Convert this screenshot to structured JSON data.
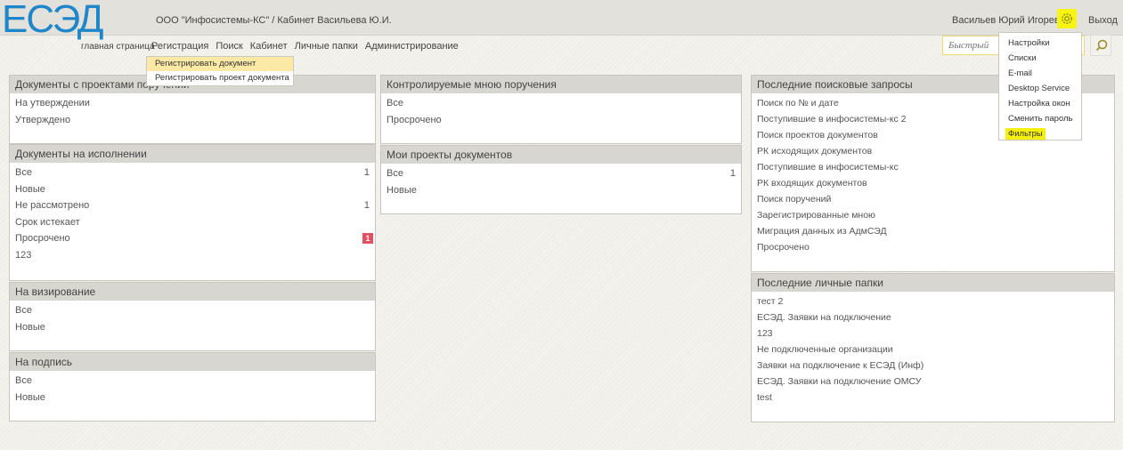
{
  "header": {
    "logo": "ЕСЭД",
    "logo_sub": "главная страница",
    "organization": "ООО \"Инфосистемы-КС\" / Кабинет Васильева Ю.И.",
    "user_name": "Васильев Юрий Игоревич",
    "logout": "Выход",
    "search_placeholder": "Быстрый",
    "accent_color": "#1f87c9",
    "highlight_color": "#f7f312"
  },
  "menu": {
    "items": [
      "Регистрация",
      "Поиск",
      "Кабинет",
      "Личные папки",
      "Администрирование"
    ]
  },
  "registration_dropdown": {
    "items": [
      "Регистрировать документ",
      "Регистрировать проект документа"
    ]
  },
  "settings_menu": {
    "items": [
      "Настройки",
      "Списки",
      "E-mail",
      "Desktop Service",
      "Настройка окон",
      "Сменить пароль",
      "Фильтры"
    ]
  },
  "panels": {
    "projects": {
      "title": "Документы с проектами поручений",
      "items": [
        "На утверждении",
        "Утверждено"
      ]
    },
    "execution": {
      "title": "Документы на исполнении",
      "items": [
        {
          "label": "Все",
          "count": "1"
        },
        {
          "label": "Новые",
          "count": ""
        },
        {
          "label": "Не рассмотрено",
          "count": "1"
        },
        {
          "label": "Срок истекает",
          "count": ""
        },
        {
          "label": "Просрочено",
          "badge": "1"
        },
        {
          "label": "123",
          "count": ""
        }
      ]
    },
    "vising": {
      "title": "На визирование",
      "items": [
        "Все",
        "Новые"
      ]
    },
    "signing": {
      "title": "На подпись",
      "items": [
        "Все",
        "Новые"
      ]
    },
    "controlled": {
      "title": "Контролируемые мною поручения",
      "items": [
        "Все",
        "Просрочено"
      ]
    },
    "my_projects": {
      "title": "Мои проекты документов",
      "items": [
        {
          "label": "Все",
          "count": "1"
        },
        {
          "label": "Новые",
          "count": ""
        }
      ]
    },
    "searches": {
      "title": "Последние поисковые запросы",
      "items": [
        "Поиск по № и дате",
        "Поступившие в инфосистемы-кс 2",
        "Поиск проектов документов",
        "РК исходящих документов",
        "Поступившие в инфосистемы-кс",
        "РК входящих документов",
        "Поиск поручений",
        "Зарегистрированные мною",
        "Миграция данных из АдмСЭД",
        "Просрочено"
      ]
    },
    "folders": {
      "title": "Последние личные папки",
      "items": [
        "тест 2",
        "ЕСЭД. Заявки на подключение",
        "123",
        "Не подключенные организации",
        "Заявки на подключение к ЕСЭД (Инф)",
        "ЕСЭД. Заявки на подключение ОМСУ",
        "test"
      ]
    }
  }
}
